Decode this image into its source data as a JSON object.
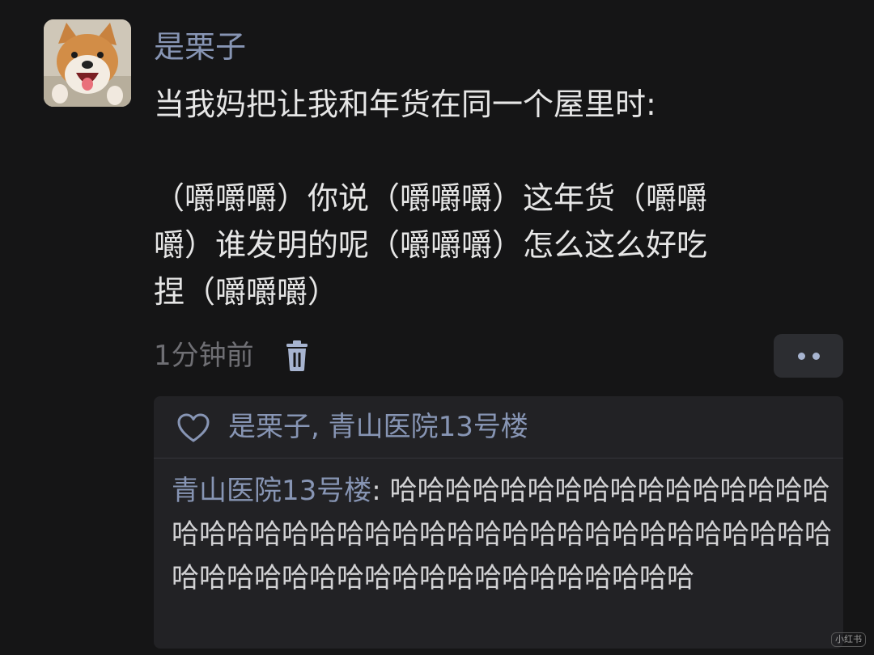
{
  "post": {
    "author": "是栗子",
    "lines": [
      "当我妈把让我和年货在同一个屋里时:",
      "（嚼嚼嚼）你说（嚼嚼嚼）这年货（嚼嚼",
      "嚼）谁发明的呢（嚼嚼嚼）怎么这么好吃",
      "捏（嚼嚼嚼）"
    ],
    "timestamp": "1分钟前",
    "avatar_icon": "shiba-dog-photo",
    "delete_icon": "trash-icon",
    "more_icon": "more-dots-icon"
  },
  "likes": {
    "icon": "heart-outline-icon",
    "names": "是栗子, 青山医院13号楼"
  },
  "comment": {
    "user": "青山医院13号楼",
    "separator": ": ",
    "text": "哈哈哈哈哈哈哈哈哈哈哈哈哈哈哈哈哈哈哈哈哈哈哈哈哈哈哈哈哈哈哈哈哈哈哈哈哈哈哈哈哈哈哈哈哈哈哈哈哈哈哈哈哈哈哈哈哈哈哈"
  },
  "watermark": "小红书",
  "colors": {
    "background": "#151516",
    "name_blue": "#8795b4",
    "text": "#e6e6e6",
    "muted": "#6f6f74",
    "panel": "#222225"
  }
}
